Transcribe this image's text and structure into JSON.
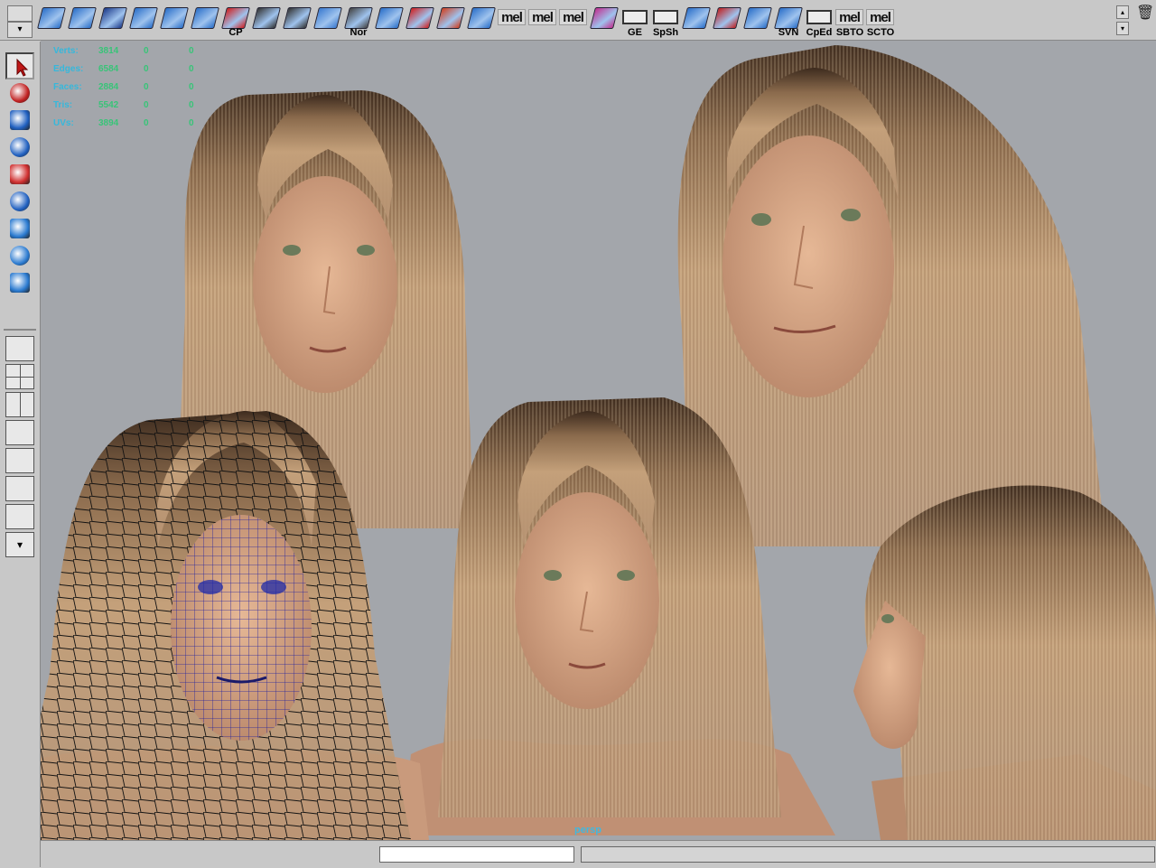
{
  "shelf": {
    "buttons": [
      {
        "icon": "poly-plane-icon",
        "label": "",
        "color": "#2a6fc9"
      },
      {
        "icon": "poly-plane2-icon",
        "label": "",
        "color": "#2a6fc9"
      },
      {
        "icon": "sphere-circle-icon",
        "label": "",
        "color": "#1c3a8a"
      },
      {
        "icon": "poly-extrude-icon",
        "label": "",
        "color": "#2a6fc9"
      },
      {
        "icon": "poly-bevel-icon",
        "label": "",
        "color": "#2a6fc9"
      },
      {
        "icon": "poly-split-icon",
        "label": "",
        "color": "#2a6fc9"
      },
      {
        "icon": "arrow-cp-icon",
        "label": "CP",
        "color": "#d02020"
      },
      {
        "icon": "checker-icon",
        "label": "",
        "color": "#333333"
      },
      {
        "icon": "checker2-icon",
        "label": "",
        "color": "#333333"
      },
      {
        "icon": "cylinder-icon",
        "label": "",
        "color": "#3a7ad0"
      },
      {
        "icon": "normal-icon",
        "label": "Nor",
        "color": "#444444"
      },
      {
        "icon": "face-normal-icon",
        "label": "",
        "color": "#2a6fc9"
      },
      {
        "icon": "pivot-icon",
        "label": "",
        "color": "#d02020"
      },
      {
        "icon": "target-icon",
        "label": "",
        "color": "#d04020"
      },
      {
        "icon": "merge-icon",
        "label": "",
        "color": "#2a6fc9"
      },
      {
        "icon": "mel-script-1",
        "label": "mel",
        "color": ""
      },
      {
        "icon": "mel-script-2",
        "label": "mel",
        "color": ""
      },
      {
        "icon": "mel-script-3",
        "label": "mel",
        "color": ""
      },
      {
        "icon": "uv-editor-icon",
        "label": "",
        "color": "#c03090"
      },
      {
        "icon": "graph-editor-icon",
        "label": "GE",
        "color": ""
      },
      {
        "icon": "spreadsheet-icon",
        "label": "SpSh",
        "color": ""
      },
      {
        "icon": "hypershade-icon",
        "label": "",
        "color": "#2a6fc9"
      },
      {
        "icon": "render-icon",
        "label": "",
        "color": "#c02020"
      },
      {
        "icon": "lattice-icon",
        "label": "",
        "color": "#2a6fc9"
      },
      {
        "icon": "svn-icon",
        "label": "SVN",
        "color": "#2a6fc9"
      },
      {
        "icon": "component-editor-icon",
        "label": "CpEd",
        "color": ""
      },
      {
        "icon": "mel-sbto",
        "label": "mel",
        "sub": "SBTO",
        "color": ""
      },
      {
        "icon": "mel-scto",
        "label": "mel",
        "sub": "SCTO",
        "color": ""
      }
    ],
    "scroll_up": "▴",
    "scroll_down": "▾",
    "tab_down": "▾",
    "trash_icon": "🗑"
  },
  "toolbox": {
    "tools": [
      {
        "name": "select-tool",
        "selected": true
      },
      {
        "name": "lasso-tool",
        "selected": false
      },
      {
        "name": "paint-select-tool",
        "selected": false
      },
      {
        "name": "move-tool",
        "selected": false
      },
      {
        "name": "rotate-tool",
        "selected": false
      },
      {
        "name": "scale-tool",
        "selected": false
      },
      {
        "name": "universal-manip-tool",
        "selected": false
      },
      {
        "name": "soft-mod-tool",
        "selected": false
      },
      {
        "name": "show-manip-tool",
        "selected": false
      }
    ],
    "layouts": [
      "single-perspective",
      "four-view",
      "two-pane",
      "outliner-pane",
      "hypershade-pane",
      "graph-pane",
      "persp-outliner",
      "layout-menu"
    ],
    "menu_arrow": "▾"
  },
  "hud": {
    "rows": [
      {
        "label": "Verts:",
        "a": "3814",
        "b": "0",
        "c": "0"
      },
      {
        "label": "Edges:",
        "a": "6584",
        "b": "0",
        "c": "0"
      },
      {
        "label": "Faces:",
        "a": "2884",
        "b": "0",
        "c": "0"
      },
      {
        "label": "Tris:",
        "a": "5542",
        "b": "0",
        "c": "0"
      },
      {
        "label": "UVs:",
        "a": "3894",
        "b": "0",
        "c": "0"
      }
    ]
  },
  "viewport": {
    "camera_label": "persp",
    "background": "#a3a6ab",
    "skin_color": "#c9997a",
    "hair_color": "#b8956c",
    "hair_dark": "#4a3424",
    "wireframe_color": "#1a1a1a",
    "mesh_color": "#2222aa"
  },
  "statusbar": {
    "command_value": "",
    "feedback_value": ""
  }
}
